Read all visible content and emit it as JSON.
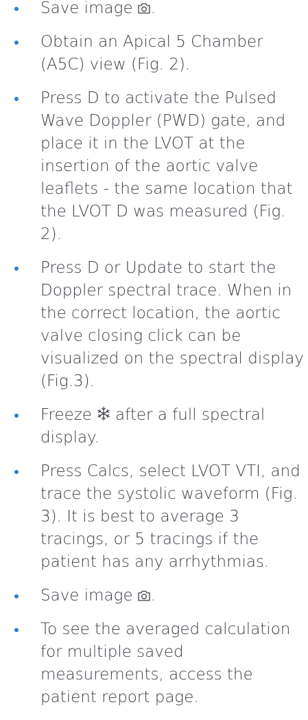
{
  "steps": [
    {
      "text": "Save image",
      "suffix": ".",
      "icon": "camera-icon"
    },
    {
      "text": "Obtain an Apical 5 Chamber (A5C) view (Fig. 2)."
    },
    {
      "text": "Press D to activate the Pulsed Wave Doppler (PWD) gate, and place it in the LVOT at the insertion of the aortic valve leaflets - the same location that the LVOT D was measured (Fig. 2)."
    },
    {
      "text": "Press D or Update to start the Doppler spectral trace. When in the correct location, the aortic valve closing click can be visualized on the spectral display (Fig.3)."
    },
    {
      "text": "Freeze",
      "icon": "snowflake-icon",
      "suffix": "after a full spectral display."
    },
    {
      "text": "Press Calcs, select LVOT VTI, and trace the systolic waveform (Fig. 3). It is best to average 3 tracings, or 5 tracings if the patient has any arrhythmias."
    },
    {
      "text": "Save image",
      "suffix": ".",
      "icon": "camera-icon"
    },
    {
      "text": "To see the averaged calculation for multiple saved measurements, access the patient report page."
    }
  ],
  "colors": {
    "bullet": "#2a7fd4",
    "text": "#3d3f47"
  }
}
